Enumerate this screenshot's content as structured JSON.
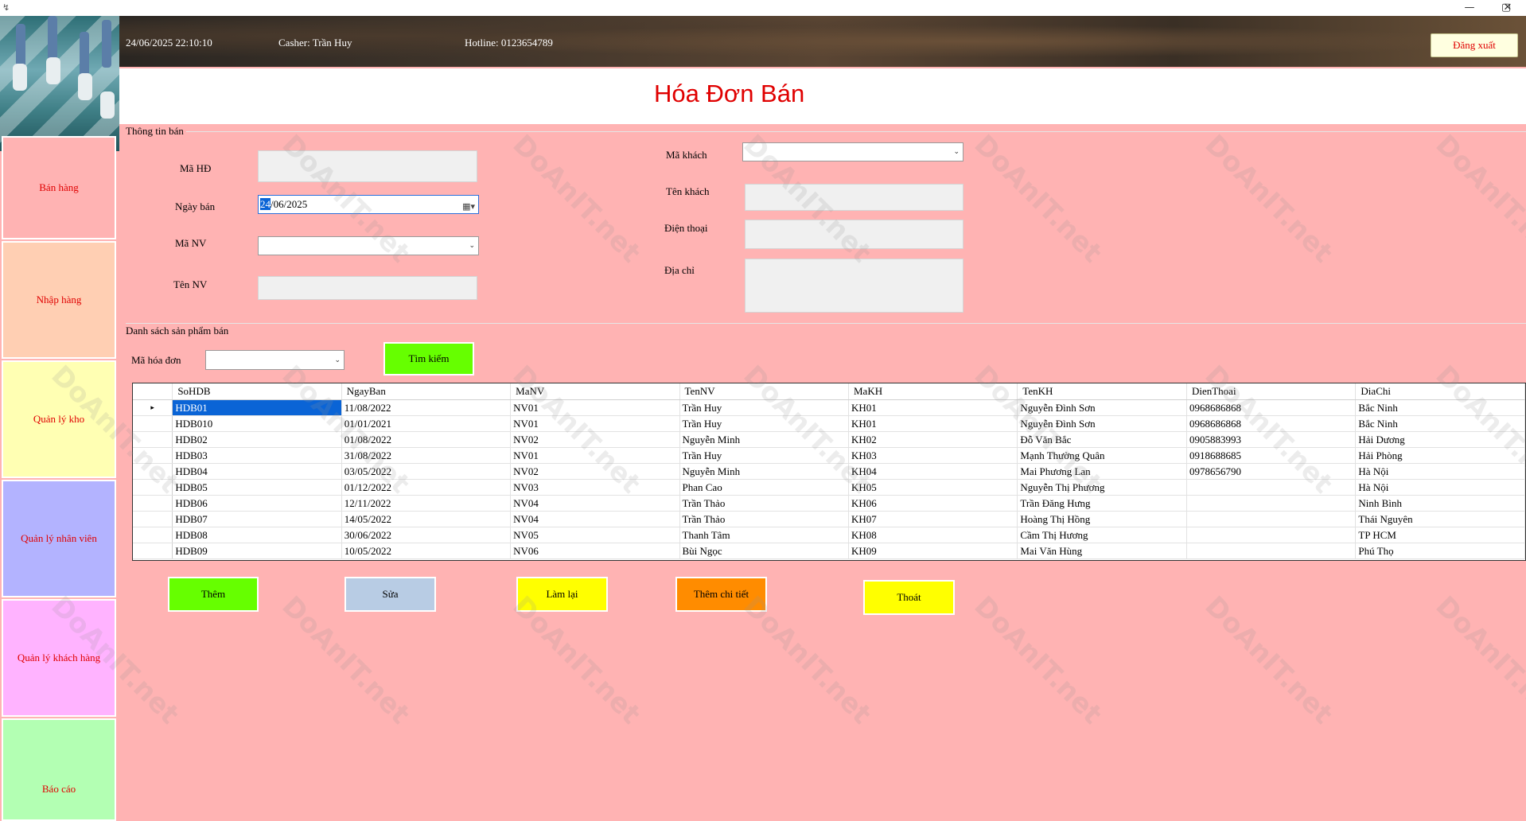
{
  "window": {
    "title_icon": "↯",
    "minimize": "—",
    "maximize": "▢",
    "close": "✕"
  },
  "header": {
    "datetime": "24/06/2025 22:10:10",
    "cashier": "Casher: Trần Huy",
    "hotline": "Hotline: 0123654789",
    "logout_label": "Đăng xuất"
  },
  "sidebar": {
    "items": [
      {
        "label": "Bán hàng",
        "color": "#ffb3b3"
      },
      {
        "label": "Nhập hàng",
        "color": "#ffcfb3"
      },
      {
        "label": "Quản lý kho",
        "color": "#ffffb3"
      },
      {
        "label": "Quản lý nhân viên",
        "color": "#b3b3ff"
      },
      {
        "label": "Quản lý khách hàng",
        "color": "#ffb3ff"
      },
      {
        "label": "Báo cáo",
        "color": "#b3ffb3"
      }
    ]
  },
  "page": {
    "title": "Hóa Đơn Bán",
    "background": "#ffb3b3",
    "accent": "#e00000"
  },
  "info_group": {
    "label": "Thông tin bán",
    "ma_hd_label": "Mã HĐ",
    "ma_hd_value": "",
    "ngay_ban_label": "Ngày bán",
    "ngay_ban_day": "24",
    "ngay_ban_rest": "/06/2025",
    "ma_nv_label": "Mã NV",
    "ma_nv_value": "",
    "ten_nv_label": "Tên NV",
    "ten_nv_value": "",
    "ma_khach_label": "Mã khách",
    "ma_khach_value": "",
    "ten_khach_label": "Tên khách",
    "ten_khach_value": "",
    "dien_thoai_label": "Điện thoại",
    "dien_thoai_value": "",
    "dia_chi_label": "Địa chỉ",
    "dia_chi_value": ""
  },
  "list_group": {
    "label": "Danh sách sản phẩm bán",
    "search_label": "Mã hóa đơn",
    "search_value": "",
    "search_button": "Tìm kiếm"
  },
  "grid": {
    "columns": [
      "SoHDB",
      "NgayBan",
      "MaNV",
      "TenNV",
      "MaKH",
      "TenKH",
      "DienThoai",
      "DiaChi"
    ],
    "rows": [
      [
        "HDB01",
        "11/08/2022",
        "NV01",
        "Trần Huy",
        "KH01",
        "Nguyễn Đình Sơn",
        "0968686868",
        "Bắc Ninh"
      ],
      [
        "HDB010",
        "01/01/2021",
        "NV01",
        "Trần Huy",
        "KH01",
        "Nguyễn Đình Sơn",
        "0968686868",
        "Bắc Ninh"
      ],
      [
        "HDB02",
        "01/08/2022",
        "NV02",
        "Nguyễn Minh",
        "KH02",
        "Đỗ Văn Bắc",
        "0905883993",
        "Hải Dương"
      ],
      [
        "HDB03",
        "31/08/2022",
        "NV01",
        "Trần Huy",
        "KH03",
        "Mạnh Thường Quân",
        "0918688685",
        "Hải Phòng"
      ],
      [
        "HDB04",
        "03/05/2022",
        "NV02",
        "Nguyễn Minh",
        "KH04",
        "Mai Phương Lan",
        "0978656790",
        "Hà Nội"
      ],
      [
        "HDB05",
        "01/12/2022",
        "NV03",
        "Phan Cao",
        "KH05",
        "Nguyễn Thị Phương",
        "",
        "Hà Nội"
      ],
      [
        "HDB06",
        "12/11/2022",
        "NV04",
        "Trần Thảo",
        "KH06",
        "Trần Đăng Hưng",
        "",
        "Ninh Bình"
      ],
      [
        "HDB07",
        "14/05/2022",
        "NV04",
        "Trần Thảo",
        "KH07",
        "Hoàng Thị Hồng",
        "",
        "Thái Nguyên"
      ],
      [
        "HDB08",
        "30/06/2022",
        "NV05",
        "Thanh Tâm",
        "KH08",
        "Cầm Thị Hương",
        "",
        "TP HCM"
      ],
      [
        "HDB09",
        "10/05/2022",
        "NV06",
        "Bùi Ngọc",
        "KH09",
        "Mai Văn Hùng",
        "",
        "Phú Thọ"
      ]
    ],
    "selected_row": 0,
    "row_marker": "▸"
  },
  "actions": {
    "them": {
      "label": "Thêm",
      "color": "#66ff00"
    },
    "sua": {
      "label": "Sửa",
      "color": "#b8cce4"
    },
    "lam_lai": {
      "label": "Làm lại",
      "color": "#ffff00"
    },
    "them_chi_tiet": {
      "label": "Thêm chi tiết",
      "color": "#ff8c00"
    },
    "thoat": {
      "label": "Thoát",
      "color": "#ffff00"
    }
  },
  "watermark": {
    "text": "DoAnIT.net"
  }
}
